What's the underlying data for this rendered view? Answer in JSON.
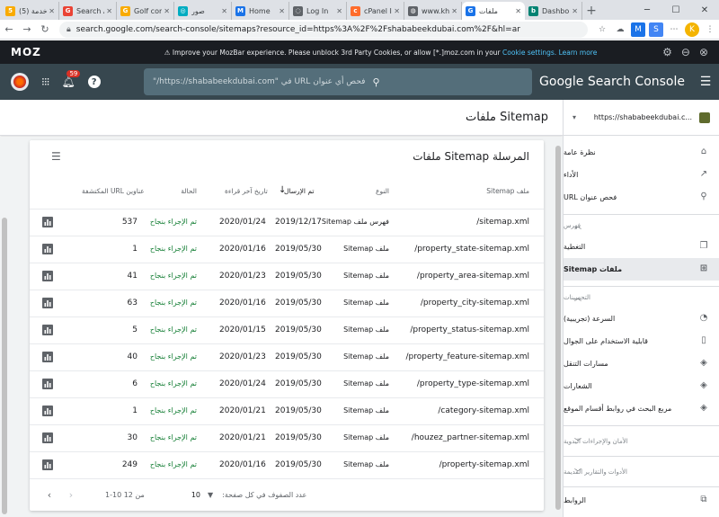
{
  "browser": {
    "tabs": [
      {
        "title": "(5) خدمة",
        "color": "#f9ab00",
        "glyph": "5"
      },
      {
        "title": "Search A",
        "color": "#ea4335",
        "glyph": "G"
      },
      {
        "title": "Golf com",
        "color": "#f9ab00",
        "glyph": "G"
      },
      {
        "title": "صور",
        "color": "#00acc1",
        "glyph": "◎"
      },
      {
        "title": "Home",
        "color": "#1a73e8",
        "glyph": "M"
      },
      {
        "title": "Log In",
        "color": "#5f6368",
        "glyph": "◌"
      },
      {
        "title": "cPanel I",
        "color": "#ff6c2c",
        "glyph": "c"
      },
      {
        "title": "www.kh",
        "color": "#5f6368",
        "glyph": "◍"
      },
      {
        "title": "ملفات",
        "color": "#1a73e8",
        "glyph": "G"
      },
      {
        "title": "Dashbo",
        "color": "#008272",
        "glyph": "b"
      }
    ],
    "url": "search.google.com/search-console/sitemaps?resource_id=https%3A%2F%2Fshababeekdubai.com%2F&hl=ar"
  },
  "mozbar": {
    "logo": "MOZ",
    "message_prefix": "⚠ Improve your MozBar experience. Please unblock 3rd Party Cookies, or allow [*.]moz.com in your ",
    "cookie_link": "Cookie settings.",
    "learn_more": "Learn more"
  },
  "gsc": {
    "notification_count": "59",
    "search_placeholder": "فحص أي عنوان URL في \"https://shababeekdubai.com/\"",
    "brand": "Google Search Console",
    "page_title": "ملفات Sitemap"
  },
  "card": {
    "title": "ملفات Sitemap المرسلة",
    "columns": {
      "sitemap": "ملف Sitemap",
      "type": "النوع",
      "submitted": "تم الإرسال",
      "last_read": "تاريخ آخر قراءة",
      "status": "الحالة",
      "discovered_urls": "عناوين URL المكتشفة"
    },
    "rows": [
      {
        "sitemap": "/sitemap.xml",
        "type": "فهرس ملف Sitemap",
        "submitted": "2019/12/17",
        "last_read": "2020/01/24",
        "status": "تم الإجراء بنجاح",
        "urls": "537"
      },
      {
        "sitemap": "/property_state-sitemap.xml",
        "type": "ملف Sitemap",
        "submitted": "2019/05/30",
        "last_read": "2020/01/16",
        "status": "تم الإجراء بنجاح",
        "urls": "1"
      },
      {
        "sitemap": "/property_area-sitemap.xml",
        "type": "ملف Sitemap",
        "submitted": "2019/05/30",
        "last_read": "2020/01/23",
        "status": "تم الإجراء بنجاح",
        "urls": "41"
      },
      {
        "sitemap": "/property_city-sitemap.xml",
        "type": "ملف Sitemap",
        "submitted": "2019/05/30",
        "last_read": "2020/01/16",
        "status": "تم الإجراء بنجاح",
        "urls": "63"
      },
      {
        "sitemap": "/property_status-sitemap.xml",
        "type": "ملف Sitemap",
        "submitted": "2019/05/30",
        "last_read": "2020/01/15",
        "status": "تم الإجراء بنجاح",
        "urls": "5"
      },
      {
        "sitemap": "/property_feature-sitemap.xml",
        "type": "ملف Sitemap",
        "submitted": "2019/05/30",
        "last_read": "2020/01/23",
        "status": "تم الإجراء بنجاح",
        "urls": "40"
      },
      {
        "sitemap": "/property_type-sitemap.xml",
        "type": "ملف Sitemap",
        "submitted": "2019/05/30",
        "last_read": "2020/01/24",
        "status": "تم الإجراء بنجاح",
        "urls": "6"
      },
      {
        "sitemap": "/category-sitemap.xml",
        "type": "ملف Sitemap",
        "submitted": "2019/05/30",
        "last_read": "2020/01/21",
        "status": "تم الإجراء بنجاح",
        "urls": "1"
      },
      {
        "sitemap": "/houzez_partner-sitemap.xml",
        "type": "ملف Sitemap",
        "submitted": "2019/05/30",
        "last_read": "2020/01/21",
        "status": "تم الإجراء بنجاح",
        "urls": "30"
      },
      {
        "sitemap": "/property-sitemap.xml",
        "type": "ملف Sitemap",
        "submitted": "2019/05/30",
        "last_read": "2020/01/16",
        "status": "تم الإجراء بنجاح",
        "urls": "249"
      }
    ],
    "pager": {
      "rows_per_page_label": "عدد الصفوف في كل صفحة:",
      "rows_per_page": "10",
      "range": "1-10 من 12"
    }
  },
  "sidebar": {
    "property": "https://shababeekdubai.c...",
    "top_items": [
      {
        "label": "نظرة عامة",
        "icon": "⌂"
      },
      {
        "label": "الأداء",
        "icon": "↗"
      },
      {
        "label": "فحص عنوان URL",
        "icon": "⚲"
      }
    ],
    "index_section": "فهرس",
    "index_items": [
      {
        "label": "التغطية",
        "icon": "❐"
      },
      {
        "label": "ملفات Sitemap",
        "icon": "⊞"
      }
    ],
    "enhancements_section": "التحسينات",
    "enhancement_items": [
      {
        "label": "السرعة (تجريبية)",
        "icon": "◔"
      },
      {
        "label": "قابلية الاستخدام على الجوال",
        "icon": "▯"
      },
      {
        "label": "مسارات التنقل",
        "icon": "◈"
      },
      {
        "label": "الشعارات",
        "icon": "◈"
      },
      {
        "label": "مربع البحث في روابط أقسام الموقع",
        "icon": "◈"
      }
    ],
    "security_section": "الأمان والإجراءات اليدوية",
    "legacy_section": "الأدوات والتقارير القديمة",
    "links_item": {
      "label": "الروابط",
      "icon": "⧉"
    }
  }
}
